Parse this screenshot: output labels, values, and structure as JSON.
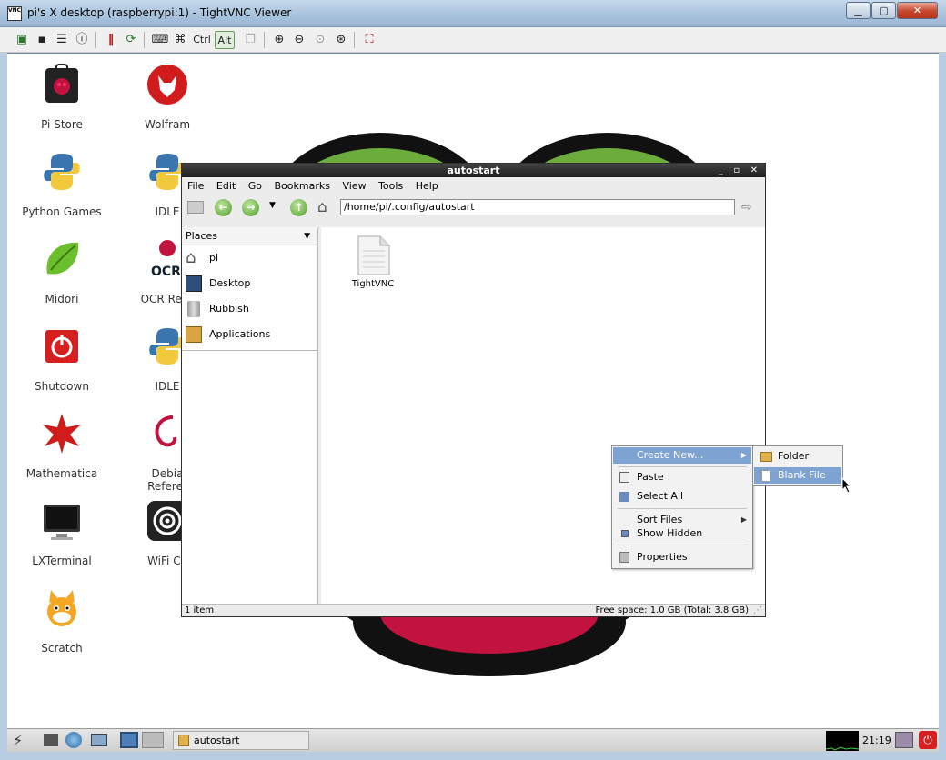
{
  "vnc": {
    "app_icon_text": "VNC",
    "title": "pi's X desktop (raspberrypi:1) - TightVNC Viewer",
    "ctrl_label": "Ctrl",
    "alt_label": "Alt"
  },
  "desktop_icons": [
    {
      "label": "Pi Store",
      "icon": "pi-store-icon"
    },
    {
      "label": "Wolfram",
      "icon": "wolfram-icon"
    },
    {
      "label": "Python Games",
      "icon": "python-icon"
    },
    {
      "label": "IDLE",
      "icon": "python-icon"
    },
    {
      "label": "Midori",
      "icon": "midori-icon"
    },
    {
      "label": "OCR Reso",
      "icon": "ocr-icon"
    },
    {
      "label": "Shutdown",
      "icon": "shutdown-icon"
    },
    {
      "label": "IDLE",
      "icon": "python-icon"
    },
    {
      "label": "Mathematica",
      "icon": "mathematica-icon"
    },
    {
      "label": "Debia Referer",
      "icon": "debian-icon"
    },
    {
      "label": "LXTerminal",
      "icon": "terminal-icon"
    },
    {
      "label": "WiFi Co",
      "icon": "wifi-icon"
    },
    {
      "label": "Scratch",
      "icon": "scratch-icon"
    }
  ],
  "file_manager": {
    "title": "autostart",
    "menus": [
      "File",
      "Edit",
      "Go",
      "Bookmarks",
      "View",
      "Tools",
      "Help"
    ],
    "address": "/home/pi/.config/autostart",
    "places_header": "Places",
    "places": [
      {
        "label": "pi",
        "icon": "home-icon"
      },
      {
        "label": "Desktop",
        "icon": "desktop-icon"
      },
      {
        "label": "Rubbish",
        "icon": "trash-icon"
      },
      {
        "label": "Applications",
        "icon": "applications-icon"
      }
    ],
    "file_name": "TightVNC",
    "status_left": "1 item",
    "status_right": "Free space: 1.0 GB (Total: 3.8 GB)"
  },
  "context_menu": {
    "create_new": "Create New...",
    "paste": "Paste",
    "select_all": "Select All",
    "sort_files": "Sort Files",
    "show_hidden": "Show Hidden",
    "properties": "Properties"
  },
  "submenu": {
    "folder": "Folder",
    "blank_file": "Blank File"
  },
  "taskbar": {
    "task_label": "autostart",
    "clock": "21:19"
  },
  "colors": {
    "highlight": "#7ea3d3",
    "berry_red": "#c2123f",
    "leaf_green": "#6cac3c"
  }
}
